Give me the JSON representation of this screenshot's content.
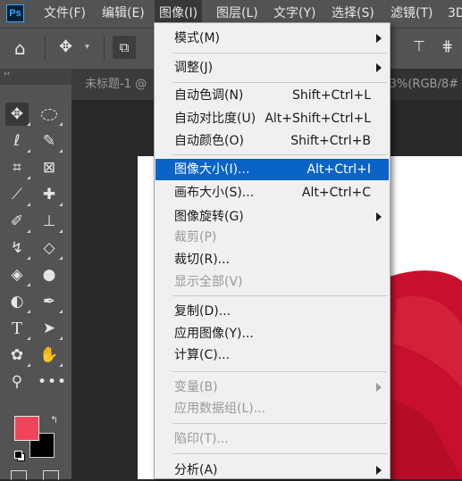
{
  "app": {
    "logo": "Ps"
  },
  "menubar": {
    "items": [
      {
        "label": "文件(F)"
      },
      {
        "label": "编辑(E)"
      },
      {
        "label": "图像(I)"
      },
      {
        "label": "图层(L)"
      },
      {
        "label": "文字(Y)"
      },
      {
        "label": "选择(S)"
      },
      {
        "label": "滤镜(T)"
      },
      {
        "label": "3D"
      }
    ]
  },
  "document": {
    "tab_title": "未标题-1 @",
    "status_right": "3%(RGB/8#"
  },
  "image_menu": {
    "items": [
      {
        "label": "模式(M)",
        "shortcut": "",
        "submenu": true,
        "disabled": false
      },
      {
        "label": "调整(J)",
        "shortcut": "",
        "submenu": true,
        "disabled": false
      },
      {
        "label": "自动色调(N)",
        "shortcut": "Shift+Ctrl+L",
        "submenu": false,
        "disabled": false
      },
      {
        "label": "自动对比度(U)",
        "shortcut": "Alt+Shift+Ctrl+L",
        "submenu": false,
        "disabled": false
      },
      {
        "label": "自动颜色(O)",
        "shortcut": "Shift+Ctrl+B",
        "submenu": false,
        "disabled": false
      },
      {
        "label": "图像大小(I)...",
        "shortcut": "Alt+Ctrl+I",
        "submenu": false,
        "disabled": false,
        "highlighted": true
      },
      {
        "label": "画布大小(S)...",
        "shortcut": "Alt+Ctrl+C",
        "submenu": false,
        "disabled": false
      },
      {
        "label": "图像旋转(G)",
        "shortcut": "",
        "submenu": true,
        "disabled": false
      },
      {
        "label": "裁剪(P)",
        "shortcut": "",
        "submenu": false,
        "disabled": true
      },
      {
        "label": "裁切(R)...",
        "shortcut": "",
        "submenu": false,
        "disabled": false
      },
      {
        "label": "显示全部(V)",
        "shortcut": "",
        "submenu": false,
        "disabled": true
      },
      {
        "label": "复制(D)...",
        "shortcut": "",
        "submenu": false,
        "disabled": false
      },
      {
        "label": "应用图像(Y)...",
        "shortcut": "",
        "submenu": false,
        "disabled": false
      },
      {
        "label": "计算(C)...",
        "shortcut": "",
        "submenu": false,
        "disabled": false
      },
      {
        "label": "变量(B)",
        "shortcut": "",
        "submenu": true,
        "disabled": true
      },
      {
        "label": "应用数据组(L)...",
        "shortcut": "",
        "submenu": false,
        "disabled": true
      },
      {
        "label": "陷印(T)...",
        "shortcut": "",
        "submenu": false,
        "disabled": true
      },
      {
        "label": "分析(A)",
        "shortcut": "",
        "submenu": true,
        "disabled": false
      }
    ]
  },
  "colors": {
    "foreground": "#f0445a",
    "background": "#000000",
    "highlight": "#0a64c8",
    "canvas_red": "#c8102e"
  }
}
